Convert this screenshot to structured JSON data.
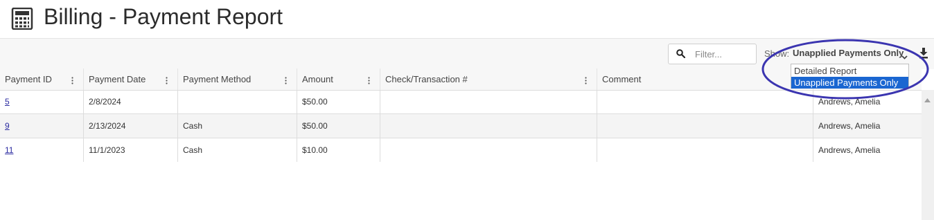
{
  "page": {
    "title": "Billing - Payment Report",
    "title_icon": "calculator-icon"
  },
  "toolbar": {
    "filter_placeholder": "Filter...",
    "filter_value": "",
    "show_label": "Show:",
    "show_value": "Unapplied Payments Only",
    "download_icon": "download-icon"
  },
  "show_dropdown": {
    "options": [
      "Detailed Report",
      "Unapplied Payments Only"
    ],
    "selected": "Unapplied Payments Only"
  },
  "table": {
    "columns": [
      "Payment ID",
      "Payment Date",
      "Payment Method",
      "Amount",
      "Check/Transaction #",
      "Comment",
      ""
    ],
    "rows": [
      {
        "payment_id": "5",
        "payment_date": "2/8/2024",
        "payment_method": "",
        "amount": "$50.00",
        "check_transaction": "",
        "comment": "",
        "name": "Andrews, Amelia"
      },
      {
        "payment_id": "9",
        "payment_date": "2/13/2024",
        "payment_method": "Cash",
        "amount": "$50.00",
        "check_transaction": "",
        "comment": "",
        "name": "Andrews, Amelia"
      },
      {
        "payment_id": "11",
        "payment_date": "11/1/2023",
        "payment_method": "Cash",
        "amount": "$10.00",
        "check_transaction": "",
        "comment": "",
        "name": "Andrews, Amelia"
      }
    ]
  },
  "colors": {
    "annotation": "#3b35b0",
    "selected_option": "#1a66d1",
    "link": "#2a2aa0"
  }
}
